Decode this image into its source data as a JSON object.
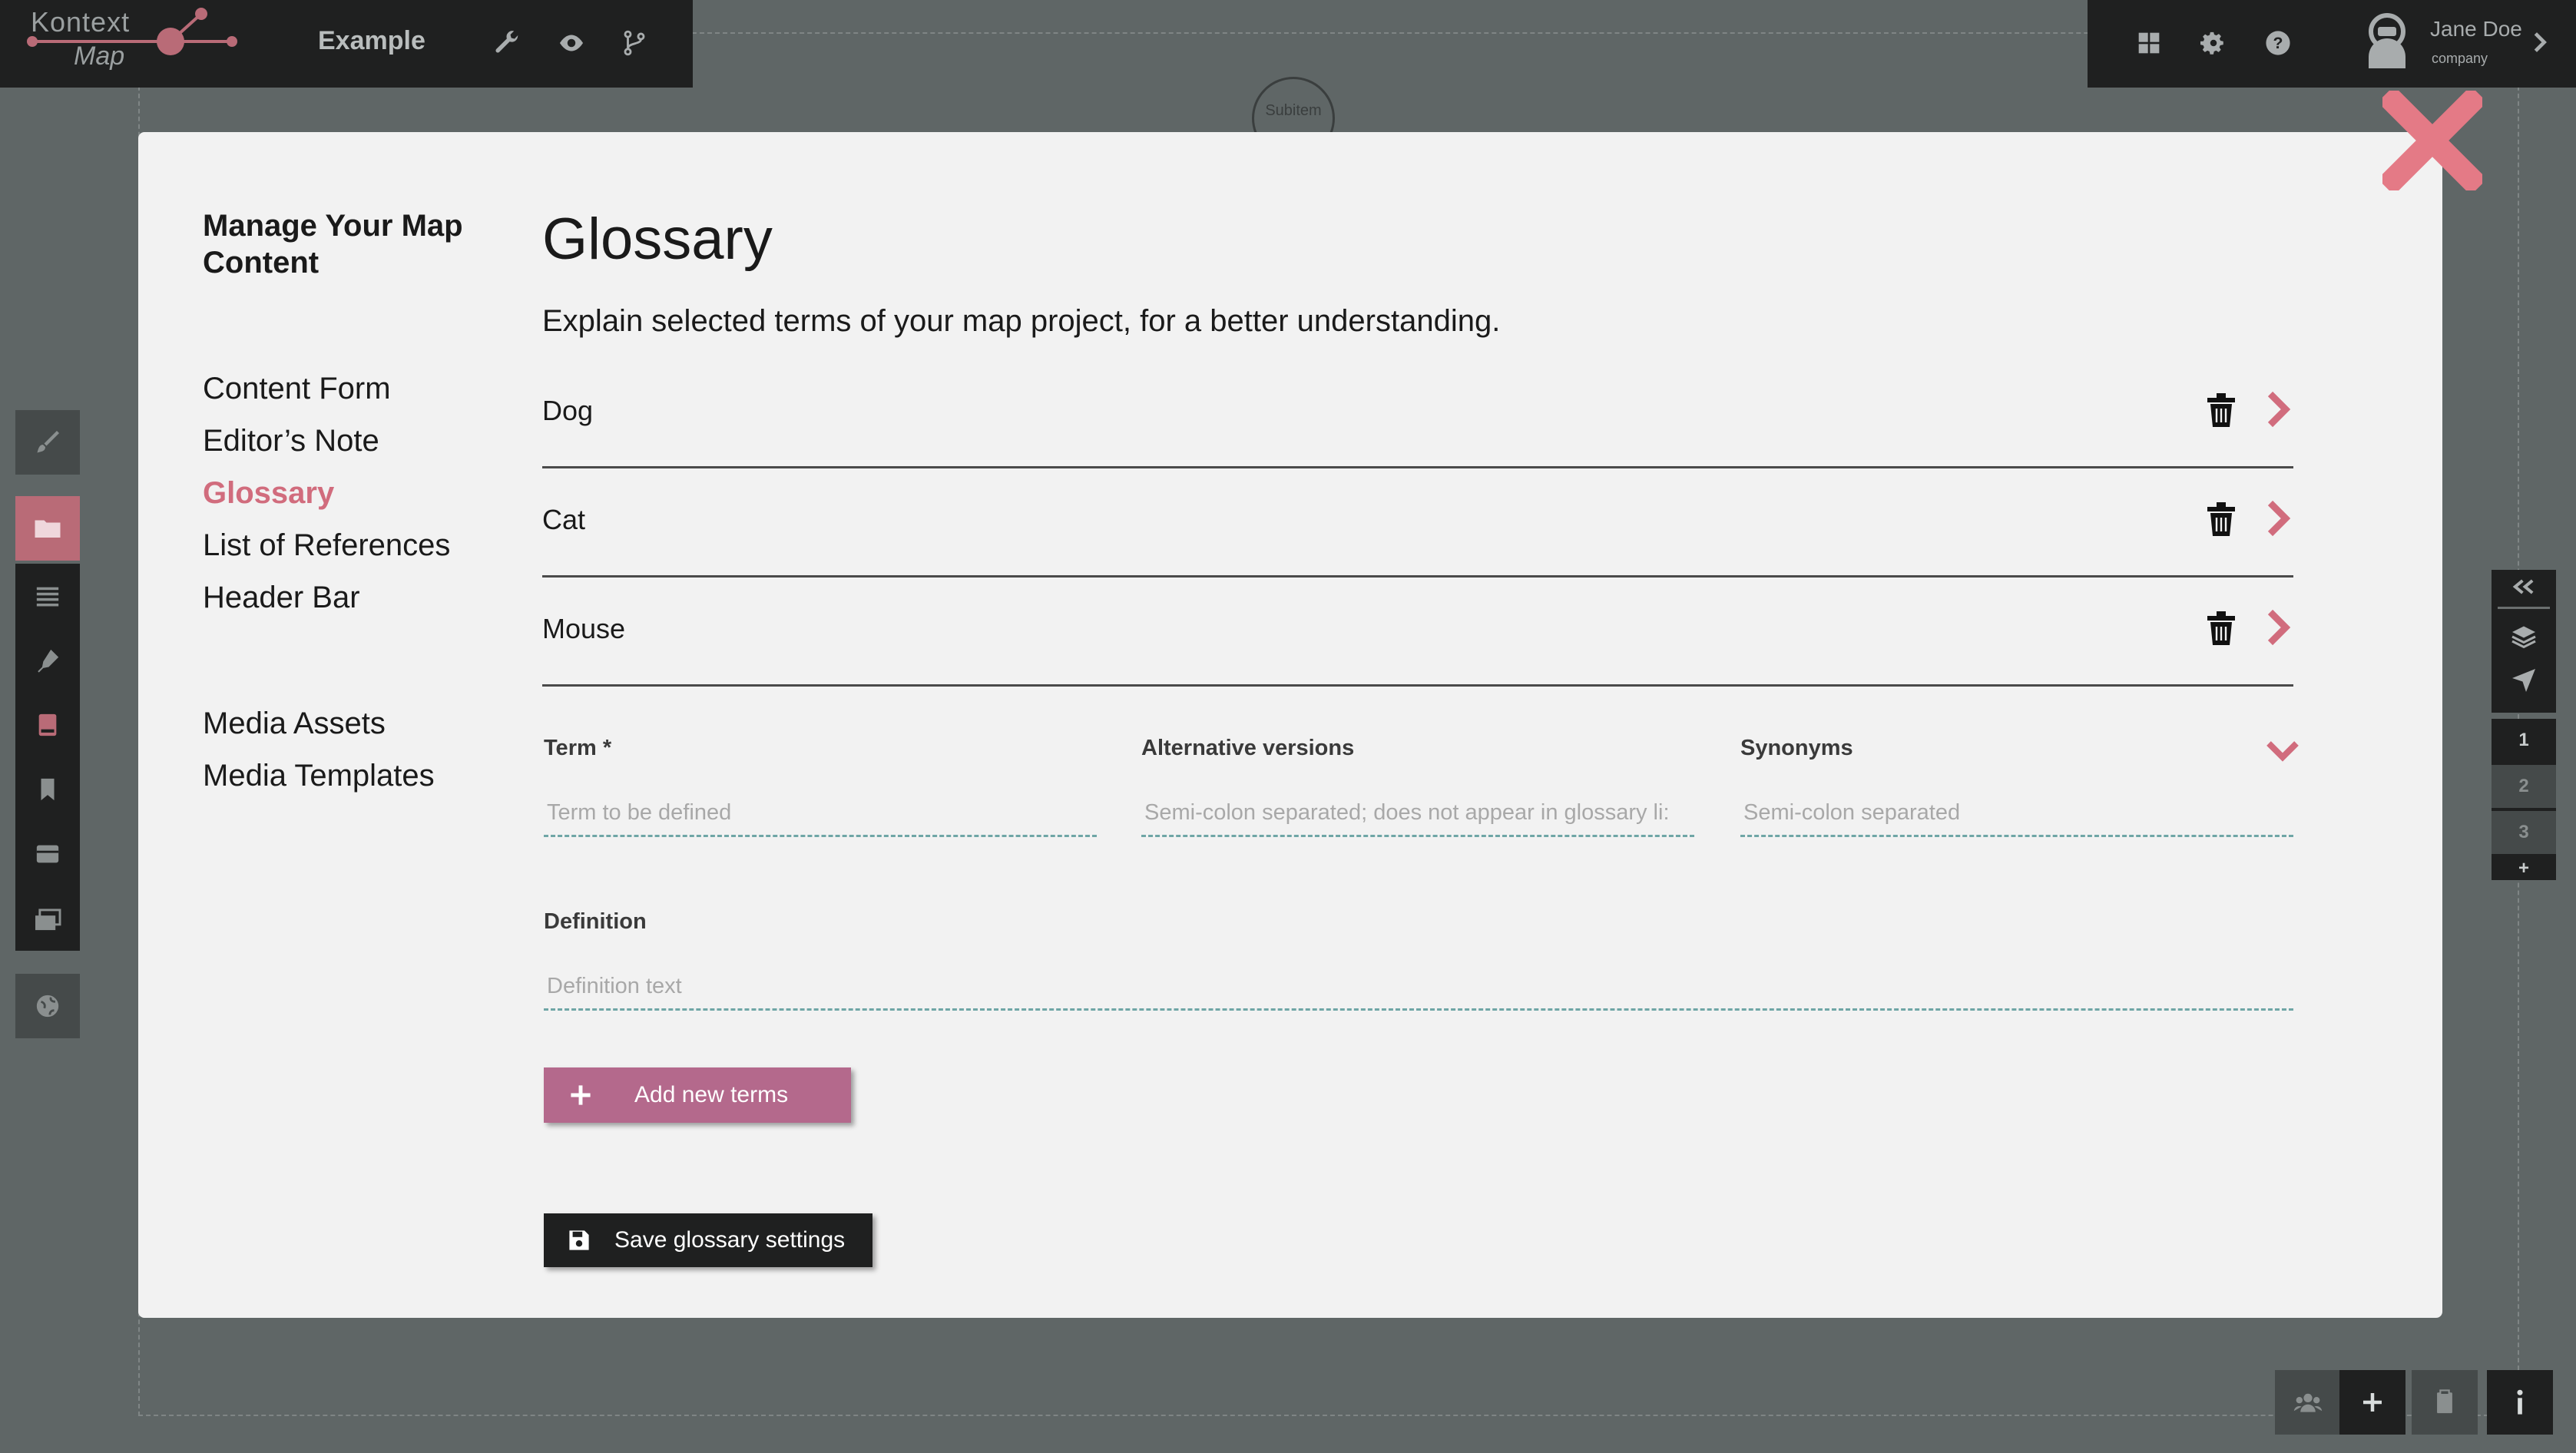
{
  "app": {
    "logo_line1": "Kontext",
    "logo_line2": "Map",
    "project_name": "Example",
    "user_name": "Jane Doe",
    "user_company": "company",
    "map_node_label": "Subitem"
  },
  "sidebar": {
    "title": "Manage Your Map Content",
    "items": [
      {
        "label": "Content Form",
        "active": false
      },
      {
        "label": "Editor’s Note",
        "active": false
      },
      {
        "label": "Glossary",
        "active": true
      },
      {
        "label": "List of References",
        "active": false
      },
      {
        "label": "Header Bar",
        "active": false
      }
    ],
    "media_items": [
      {
        "label": "Media Assets"
      },
      {
        "label": "Media Templates"
      }
    ]
  },
  "main": {
    "title": "Glossary",
    "description": "Explain selected terms of your map project, for a better understanding.",
    "terms": [
      "Dog",
      "Cat",
      "Mouse"
    ],
    "form": {
      "term_label": "Term *",
      "term_placeholder": "Term to be defined",
      "alt_label": "Alternative versions",
      "alt_placeholder": "Semi-colon separated; does not appear in glossary li:",
      "syn_label": "Synonyms",
      "syn_placeholder": "Semi-colon separated",
      "def_label": "Definition",
      "def_placeholder": "Definition text"
    },
    "add_button": "Add new terms",
    "save_button": "Save glossary settings"
  },
  "right_panel": {
    "layers": [
      "1",
      "2",
      "3"
    ],
    "add": "+"
  },
  "colors": {
    "accent": "#d16c7d",
    "add_button": "#b4698c",
    "dark": "#1f2020",
    "modal_bg": "#f2f2f2",
    "backdrop": "#5f6666"
  }
}
